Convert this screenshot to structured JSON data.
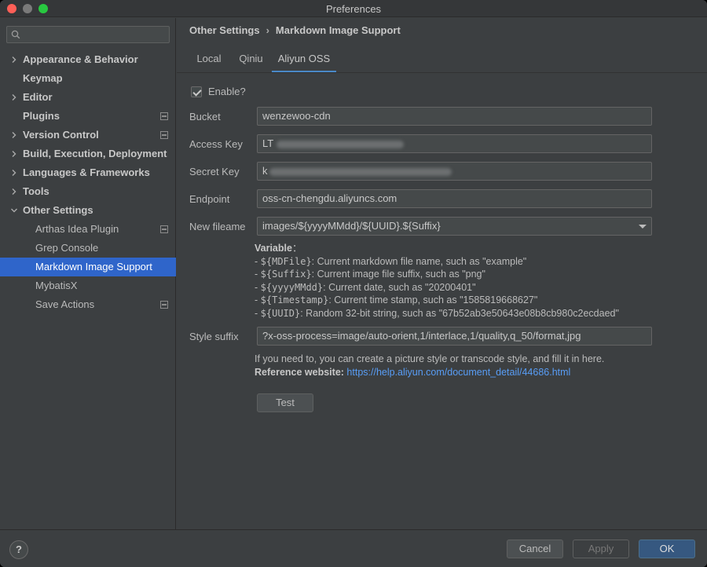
{
  "window": {
    "title": "Preferences"
  },
  "sidebar": {
    "search": {
      "placeholder": "",
      "value": ""
    },
    "items": [
      {
        "label": "Appearance & Behavior",
        "expandable": true,
        "expanded": false,
        "bold": true,
        "project_icon": false
      },
      {
        "label": "Keymap",
        "expandable": false,
        "bold": true,
        "project_icon": false
      },
      {
        "label": "Editor",
        "expandable": true,
        "expanded": false,
        "bold": true,
        "project_icon": false
      },
      {
        "label": "Plugins",
        "expandable": false,
        "bold": true,
        "project_icon": true
      },
      {
        "label": "Version Control",
        "expandable": true,
        "expanded": false,
        "bold": true,
        "project_icon": true
      },
      {
        "label": "Build, Execution, Deployment",
        "expandable": true,
        "expanded": false,
        "bold": true,
        "project_icon": false
      },
      {
        "label": "Languages & Frameworks",
        "expandable": true,
        "expanded": false,
        "bold": true,
        "project_icon": false
      },
      {
        "label": "Tools",
        "expandable": true,
        "expanded": false,
        "bold": true,
        "project_icon": false
      },
      {
        "label": "Other Settings",
        "expandable": true,
        "expanded": true,
        "bold": true,
        "project_icon": false
      },
      {
        "label": "Arthas Idea Plugin",
        "child": true,
        "project_icon": true
      },
      {
        "label": "Grep Console",
        "child": true,
        "project_icon": false
      },
      {
        "label": "Markdown Image Support",
        "child": true,
        "selected": true,
        "project_icon": false
      },
      {
        "label": "MybatisX",
        "child": true,
        "project_icon": false
      },
      {
        "label": "Save Actions",
        "child": true,
        "project_icon": true
      }
    ]
  },
  "breadcrumb": {
    "parent": "Other Settings",
    "separator": "›",
    "current": "Markdown Image Support"
  },
  "tabs": [
    {
      "label": "Local",
      "active": false
    },
    {
      "label": "Qiniu",
      "active": false
    },
    {
      "label": "Aliyun OSS",
      "active": true
    }
  ],
  "form": {
    "enable": {
      "label": "Enable?",
      "checked": true
    },
    "bucket": {
      "label": "Bucket",
      "value": "wenzewoo-cdn"
    },
    "access_key": {
      "label": "Access Key",
      "visible_prefix": "LT"
    },
    "secret_key": {
      "label": "Secret Key",
      "visible_prefix": "k"
    },
    "endpoint": {
      "label": "Endpoint",
      "value": "oss-cn-chengdu.aliyuncs.com"
    },
    "new_filename": {
      "label": "New fileame",
      "value": "images/${yyyyMMdd}/${UUID}.${Suffix}"
    },
    "variables": {
      "title": "Variable",
      "title_suffix": "：",
      "items": [
        {
          "prefix": "- ",
          "name": "${MDFile}",
          "desc": ": Current markdown file name, such as \"example\""
        },
        {
          "prefix": "- ",
          "name": "${Suffix}",
          "desc": ": Current image file suffix, such as \"png\""
        },
        {
          "prefix": "- ",
          "name": "${yyyyMMdd}",
          "desc": ": Current date, such as \"20200401\""
        },
        {
          "prefix": "- ",
          "name": "${Timestamp}",
          "desc": ": Current time stamp, such as \"1585819668627\""
        },
        {
          "prefix": "- ",
          "name": "${UUID}",
          "desc": ": Random 32-bit string, such as \"67b52ab3e50643e08b8cb980c2ecdaed\""
        }
      ]
    },
    "style_suffix": {
      "label": "Style suffix",
      "value": "?x-oss-process=image/auto-orient,1/interlace,1/quality,q_50/format,jpg"
    },
    "help_text": "If you need to, you can create a picture style or transcode style, and fill it in here.",
    "reference_label": "Reference website:",
    "reference_url": "https://help.aliyun.com/document_detail/44686.html",
    "test_button": "Test"
  },
  "footer": {
    "help_icon": "?",
    "cancel": "Cancel",
    "apply": "Apply",
    "ok": "OK"
  },
  "colors": {
    "background": "#3c3f41",
    "selection": "#2f65ca",
    "accent_tab": "#4a88c7",
    "link": "#589df6",
    "primary_button": "#365880"
  }
}
